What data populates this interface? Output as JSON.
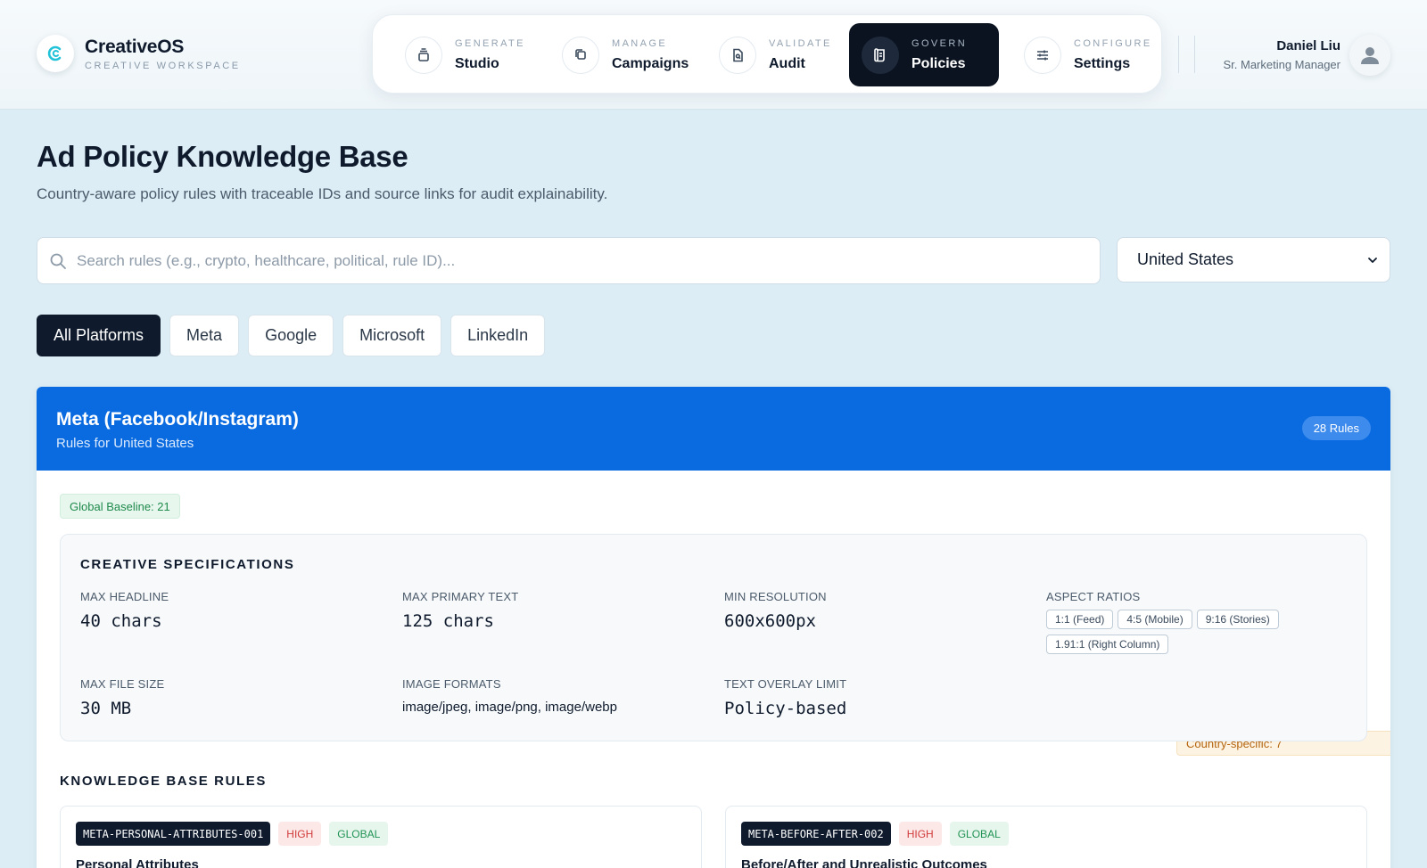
{
  "brand": {
    "name": "CreativeOS",
    "subtitle": "CREATIVE WORKSPACE",
    "logo_icon": "c-logo-icon"
  },
  "nav": {
    "items": [
      {
        "kicker": "GENERATE",
        "label": "Studio",
        "icon": "layers-icon"
      },
      {
        "kicker": "MANAGE",
        "label": "Campaigns",
        "icon": "copy-icon"
      },
      {
        "kicker": "VALIDATE",
        "label": "Audit",
        "icon": "document-search-icon"
      },
      {
        "kicker": "GOVERN",
        "label": "Policies",
        "icon": "scroll-icon",
        "active": true
      },
      {
        "kicker": "CONFIGURE",
        "label": "Settings",
        "icon": "sliders-icon"
      }
    ]
  },
  "user": {
    "name": "Daniel Liu",
    "role": "Sr. Marketing Manager"
  },
  "page": {
    "title": "Ad Policy Knowledge Base",
    "subtitle": "Country-aware policy rules with traceable IDs and source links for audit explainability."
  },
  "search": {
    "placeholder": "Search rules (e.g., crypto, healthcare, political, rule ID)...",
    "value": ""
  },
  "country_select": {
    "selected": "United States"
  },
  "platform_tabs": [
    "All Platforms",
    "Meta",
    "Google",
    "Microsoft",
    "LinkedIn"
  ],
  "active_tab": "All Platforms",
  "panel": {
    "title": "Meta (Facebook/Instagram)",
    "subtitle": "Rules for United States",
    "rules_count": "28 Rules",
    "global_baseline": "Global Baseline: 21",
    "country_specific": "Country-specific: 7",
    "accent_color": "#0a6be0"
  },
  "specs": {
    "title": "CREATIVE SPECIFICATIONS",
    "max_headline": {
      "label": "MAX HEADLINE",
      "value": "40 chars"
    },
    "max_primary_text": {
      "label": "MAX PRIMARY TEXT",
      "value": "125 chars"
    },
    "min_resolution": {
      "label": "MIN RESOLUTION",
      "value": "600x600px"
    },
    "aspect_ratios": {
      "label": "ASPECT RATIOS",
      "values": [
        "1:1 (Feed)",
        "4:5 (Mobile)",
        "9:16 (Stories)",
        "1.91:1 (Right Column)"
      ]
    },
    "max_file_size": {
      "label": "MAX FILE SIZE",
      "value": "30 MB"
    },
    "image_formats": {
      "label": "IMAGE FORMATS",
      "value": "image/jpeg, image/png, image/webp"
    },
    "text_overlay": {
      "label": "TEXT OVERLAY LIMIT",
      "value": "Policy-based"
    }
  },
  "kb": {
    "title": "KNOWLEDGE BASE RULES",
    "rules": [
      {
        "id": "META-PERSONAL-ATTRIBUTES-001",
        "severity": "HIGH",
        "scope": "GLOBAL",
        "name": "Personal Attributes"
      },
      {
        "id": "META-BEFORE-AFTER-002",
        "severity": "HIGH",
        "scope": "GLOBAL",
        "name": "Before/After and Unrealistic Outcomes"
      }
    ]
  }
}
